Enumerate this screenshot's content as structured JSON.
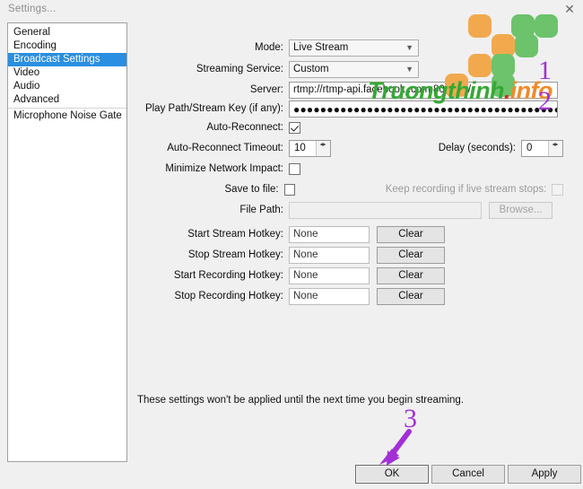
{
  "window": {
    "title": "Settings...",
    "close_icon": "close-icon"
  },
  "sidebar": {
    "items": [
      {
        "label": "General",
        "selected": false
      },
      {
        "label": "Encoding",
        "selected": false
      },
      {
        "label": "Broadcast Settings",
        "selected": true
      },
      {
        "label": "Video",
        "selected": false
      },
      {
        "label": "Audio",
        "selected": false
      },
      {
        "label": "Advanced",
        "selected": false
      },
      {
        "label": "Microphone Noise Gate",
        "selected": false
      }
    ],
    "selected_color": "#2a8fe0"
  },
  "form": {
    "mode": {
      "label": "Mode:",
      "value": "Live Stream"
    },
    "streaming_service": {
      "label": "Streaming Service:",
      "value": "Custom"
    },
    "server": {
      "label": "Server:",
      "value": "rtmp://rtmp-api.facebook..com:80/rtmp/"
    },
    "stream_key": {
      "label": "Play Path/Stream Key (if any):",
      "value": "●●●●●●●●●●●●●●●●●●●●●●●●●●●●●●●●●●●●●●●●●●●●●●●●●●●●●"
    },
    "auto_reconnect": {
      "label": "Auto-Reconnect:",
      "checked": true
    },
    "auto_reconnect_timeout": {
      "label": "Auto-Reconnect Timeout:",
      "value": "10"
    },
    "delay": {
      "label": "Delay (seconds):",
      "value": "0"
    },
    "minimize_network_impact": {
      "label": "Minimize Network Impact:",
      "checked": false
    },
    "save_to_file": {
      "label": "Save to file:",
      "checked": false
    },
    "keep_recording": {
      "label": "Keep recording if live stream stops:",
      "checked": false,
      "disabled": true
    },
    "file_path": {
      "label": "File Path:",
      "value": "",
      "disabled": true
    },
    "browse_button": {
      "label": "Browse...",
      "disabled": true
    },
    "hotkeys": [
      {
        "label": "Start Stream Hotkey:",
        "value": "None",
        "clear_label": "Clear"
      },
      {
        "label": "Stop Stream Hotkey:",
        "value": "None",
        "clear_label": "Clear"
      },
      {
        "label": "Start Recording Hotkey:",
        "value": "None",
        "clear_label": "Clear"
      },
      {
        "label": "Stop Recording Hotkey:",
        "value": "None",
        "clear_label": "Clear"
      }
    ],
    "footnote": "These settings won't be applied until the next time you begin streaming."
  },
  "buttons": {
    "ok": "OK",
    "cancel": "Cancel",
    "apply": "Apply"
  },
  "annotations": {
    "one": "1",
    "two": "2",
    "three": "3",
    "color": "#a32fd6"
  },
  "watermark": {
    "text_green": "Truongthinh",
    "text_dot": ".",
    "text_orange": "info",
    "green": "#35a935",
    "orange": "#f08a2c",
    "red": "#d52b2b"
  }
}
